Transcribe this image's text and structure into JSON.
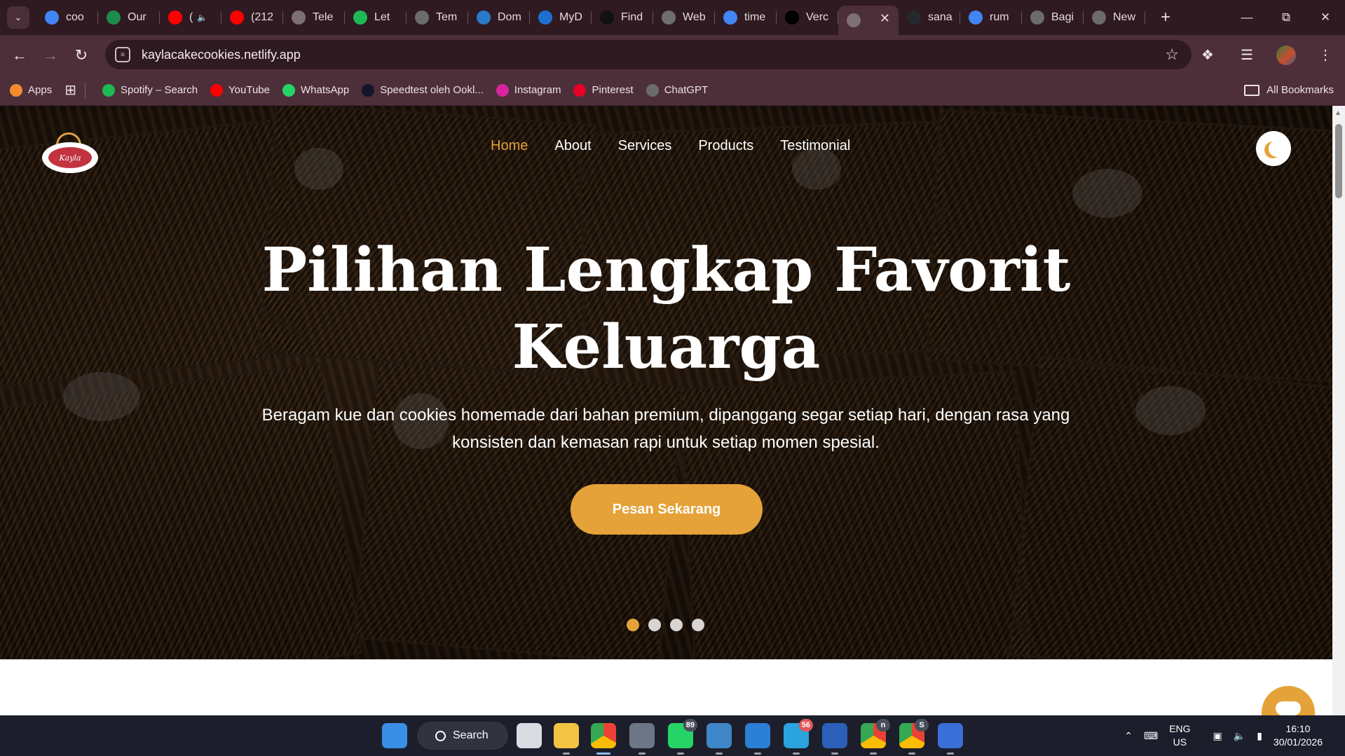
{
  "browser": {
    "tabs": [
      {
        "label": "coo",
        "icon": "google-icon",
        "color": "#4285F4"
      },
      {
        "label": "Our",
        "icon": "shield-icon",
        "color": "#1e8c4a"
      },
      {
        "label": "(",
        "icon": "youtube-icon",
        "color": "#ff0000",
        "audio": "🔈"
      },
      {
        "label": "(212",
        "icon": "youtube-icon",
        "color": "#ff0000"
      },
      {
        "label": "Tele",
        "icon": "globe-icon",
        "color": "#7d6f76"
      },
      {
        "label": "Let",
        "icon": "spotify-icon",
        "color": "#1db954"
      },
      {
        "label": "Tem",
        "icon": "openai-icon",
        "color": "#6b6b6b"
      },
      {
        "label": "Dom",
        "icon": "dn-icon",
        "color": "#2b79c9"
      },
      {
        "label": "MyD",
        "icon": "myd-icon",
        "color": "#1f6fd1"
      },
      {
        "label": "Find",
        "icon": "tiktok-icon",
        "color": "#111111"
      },
      {
        "label": "Web",
        "icon": "web-icon",
        "color": "#6e6e6e"
      },
      {
        "label": "time",
        "icon": "google-icon",
        "color": "#4285F4"
      },
      {
        "label": "Verc",
        "icon": "vercel-icon",
        "color": "#000000"
      },
      {
        "label": "",
        "icon": "globe-icon",
        "color": "#7d6f76",
        "active": true
      },
      {
        "label": "sana",
        "icon": "github-icon",
        "color": "#24292e"
      },
      {
        "label": "rum",
        "icon": "google-icon",
        "color": "#4285F4"
      },
      {
        "label": "Bagi",
        "icon": "openai-icon",
        "color": "#6b6b6b"
      },
      {
        "label": "New",
        "icon": "chrome-icon",
        "color": "#6b6b6b"
      }
    ],
    "url": "kaylacakecookies.netlify.app",
    "bookmarks": [
      {
        "label": "Apps",
        "icon": "apps-grid-icon",
        "color": "#f28b30"
      },
      {
        "label": "Spotify – Search",
        "icon": "spotify-icon",
        "color": "#1db954"
      },
      {
        "label": "YouTube",
        "icon": "youtube-icon",
        "color": "#ff0000"
      },
      {
        "label": "WhatsApp",
        "icon": "whatsapp-icon",
        "color": "#25d366"
      },
      {
        "label": "Speedtest oleh Ookl...",
        "icon": "speedtest-icon",
        "color": "#141526"
      },
      {
        "label": "Instagram",
        "icon": "instagram-icon",
        "color": "#d6249f"
      },
      {
        "label": "Pinterest",
        "icon": "pinterest-icon",
        "color": "#e60023"
      },
      {
        "label": "ChatGPT",
        "icon": "openai-icon",
        "color": "#6b6b6b"
      }
    ],
    "all_bookmarks": "All Bookmarks"
  },
  "site": {
    "logo_text": "Kayla",
    "nav": [
      "Home",
      "About",
      "Services",
      "Products",
      "Testimonial"
    ],
    "active_nav": "Home",
    "accent": "#e5a238",
    "hero_title_line1": "Pilihan Lengkap Favorit",
    "hero_title_line2": "Keluarga",
    "hero_subtitle_line1": "Beragam kue dan cookies homemade dari bahan premium, dipanggang segar setiap hari, dengan rasa yang",
    "hero_subtitle_line2": "konsisten dan kemasan rapi untuk setiap momen spesial.",
    "cta_label": "Pesan Sekarang",
    "slides": 4,
    "active_slide": 1
  },
  "taskbar": {
    "search_label": "Search",
    "apps": [
      {
        "name": "windows-start-icon",
        "badge": ""
      },
      {
        "name": "task-view-icon",
        "badge": ""
      },
      {
        "name": "file-explorer-icon",
        "badge": ""
      },
      {
        "name": "chrome-icon",
        "badge": ""
      },
      {
        "name": "settings-icon",
        "badge": ""
      },
      {
        "name": "whatsapp-icon",
        "badge": "89"
      },
      {
        "name": "photos-icon",
        "badge": ""
      },
      {
        "name": "vscode-icon",
        "badge": ""
      },
      {
        "name": "telegram-icon",
        "badge": "56"
      },
      {
        "name": "word-icon",
        "badge": ""
      },
      {
        "name": "chrome-profile-icon",
        "badge": "n"
      },
      {
        "name": "chrome-profile-icon",
        "badge": "S"
      },
      {
        "name": "arc-icon",
        "badge": ""
      }
    ],
    "lang_line1": "ENG",
    "lang_line2": "US",
    "time": "16:10",
    "date": "30/01/2026"
  }
}
